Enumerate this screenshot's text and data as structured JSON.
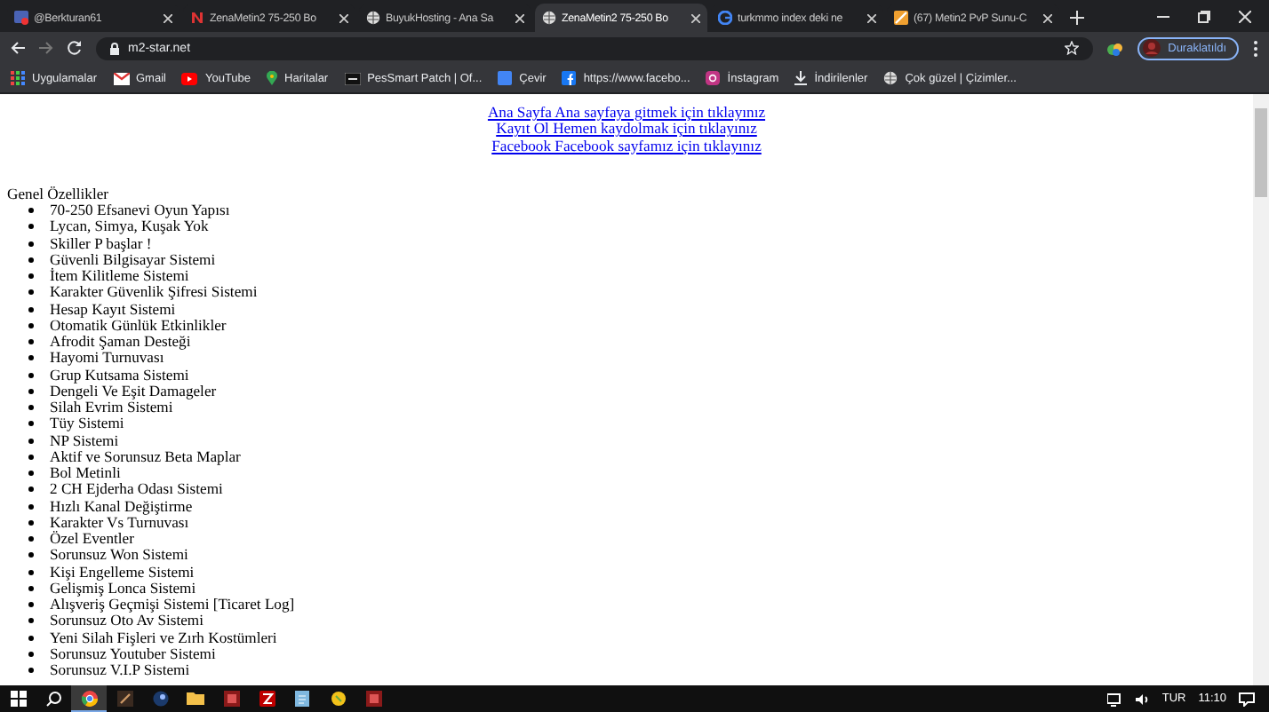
{
  "tabs": [
    {
      "title": "@Berkturan61",
      "kind": "mail",
      "selected": false
    },
    {
      "title": "ZenaMetin2 75-250 Bo",
      "kind": "zena",
      "selected": false
    },
    {
      "title": "BuyukHosting - Ana Sa",
      "kind": "globe",
      "selected": false
    },
    {
      "title": "ZenaMetin2 75-250 Bo",
      "kind": "globe",
      "selected": true
    },
    {
      "title": "turkmmo index deki ne",
      "kind": "google",
      "selected": false
    },
    {
      "title": "(67) Metin2 PvP Sunu-C",
      "kind": "forum",
      "selected": false
    }
  ],
  "address": "m2-star.net",
  "profile_button": "Duraklatıldı",
  "bookmarks": [
    {
      "label": "Uygulamalar",
      "kind": "apps"
    },
    {
      "label": "Gmail",
      "kind": "gmail"
    },
    {
      "label": "YouTube",
      "kind": "youtube"
    },
    {
      "label": "Haritalar",
      "kind": "maps"
    },
    {
      "label": "PesSmart Patch | Of...",
      "kind": "pes"
    },
    {
      "label": "Çevir",
      "kind": "translate"
    },
    {
      "label": "https://www.facebo...",
      "kind": "facebook"
    },
    {
      "label": "İnstagram",
      "kind": "instagram"
    },
    {
      "label": "İndirilenler",
      "kind": "download"
    },
    {
      "label": "Çok güzel | Çizimler...",
      "kind": "globe"
    }
  ],
  "links": [
    "Ana Sayfa Ana sayfaya gitmek için tıklayınız",
    "Kayıt Ol Hemen kaydolmak için tıklayınız",
    "Facebook Facebook sayfamız için tıklayınız"
  ],
  "heading": "Genel Özellikler",
  "features": [
    "70-250 Efsanevi Oyun Yapısı",
    "Lycan, Simya, Kuşak Yok",
    "Skiller P başlar !",
    "Güvenli Bilgisayar Sistemi",
    "İtem Kilitleme Sistemi",
    "Karakter Güvenlik Şifresi Sistemi",
    "Hesap Kayıt Sistemi",
    "Otomatik Günlük Etkinlikler",
    "Afrodit Şaman Desteği",
    "Hayomi Turnuvası",
    "Grup Kutsama Sistemi",
    "Dengeli Ve Eşit Damageler",
    "Silah Evrim Sistemi",
    "Tüy Sistemi",
    "NP Sistemi",
    "Aktif ve Sorunsuz Beta Maplar",
    "Bol Metinli",
    "2 CH Ejderha Odası Sistemi",
    "Hızlı Kanal Değiştirme",
    "Karakter Vs Turnuvası",
    "Özel Eventler",
    "Sorunsuz Won Sistemi",
    "Kişi Engelleme Sistemi",
    "Gelişmiş Lonca Sistemi",
    "Alışveriş Geçmişi Sistemi [Ticaret Log]",
    "Sorunsuz Oto Av Sistemi",
    "Yeni Silah Fişleri ve Zırh Kostümleri",
    "Sorunsuz Youtuber Sistemi",
    "Sorunsuz V.I.P Sistemi"
  ],
  "taskbar": {
    "apps": [
      {
        "kind": "chrome",
        "selected": true
      },
      {
        "kind": "game",
        "selected": false
      },
      {
        "kind": "steam",
        "selected": false
      },
      {
        "kind": "folder",
        "selected": false
      },
      {
        "kind": "red",
        "selected": false
      },
      {
        "kind": "filezilla",
        "selected": false
      },
      {
        "kind": "notes",
        "selected": false
      },
      {
        "kind": "yellow",
        "selected": false
      },
      {
        "kind": "red",
        "selected": false
      }
    ],
    "language": "TUR",
    "time": "11:10"
  }
}
